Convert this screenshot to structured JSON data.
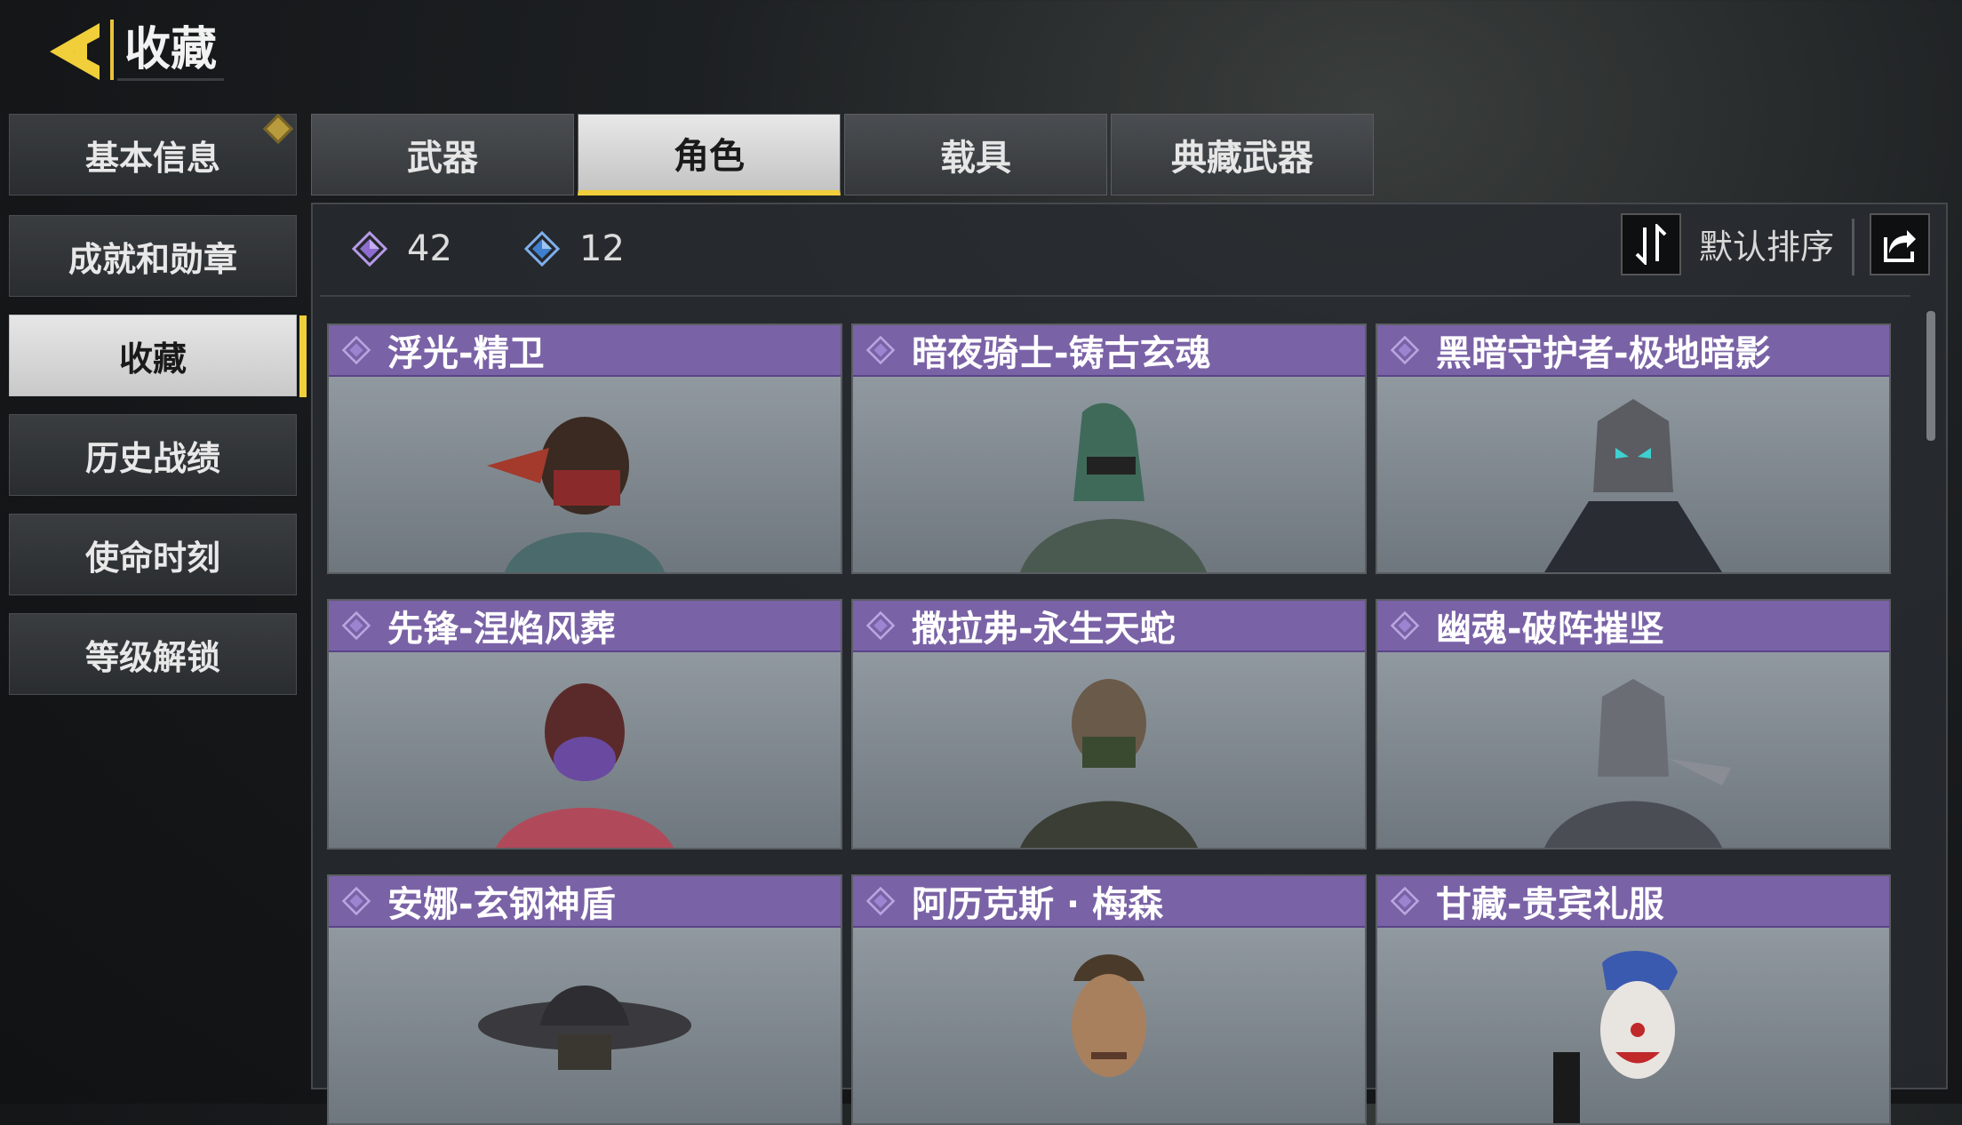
{
  "header": {
    "title": "收藏"
  },
  "sidebar": {
    "items": [
      {
        "label": "基本信息"
      },
      {
        "label": "成就和勋章"
      },
      {
        "label": "收藏"
      },
      {
        "label": "历史战绩"
      },
      {
        "label": "使命时刻"
      },
      {
        "label": "等级解锁"
      }
    ],
    "active_index": 2
  },
  "tabs": [
    {
      "label": "武器"
    },
    {
      "label": "角色"
    },
    {
      "label": "载具"
    },
    {
      "label": "典藏武器"
    }
  ],
  "active_tab": 1,
  "counts": {
    "purple": "42",
    "blue": "12"
  },
  "sort": {
    "label": "默认排序"
  },
  "cards": [
    {
      "name": "浮光-精卫"
    },
    {
      "name": "暗夜骑士-铸古玄魂"
    },
    {
      "name": "黑暗守护者-极地暗影"
    },
    {
      "name": "先锋-涅焰风葬"
    },
    {
      "name": "撒拉弗-永生天蛇"
    },
    {
      "name": "幽魂-破阵摧坚"
    },
    {
      "name": "安娜-玄钢神盾"
    },
    {
      "name": "阿历克斯 · 梅森"
    },
    {
      "name": "甘藏-贵宾礼服"
    }
  ],
  "colors": {
    "accent": "#f0cf3a",
    "card_header": "#7a62a6",
    "gem_purple": "#9a7ad8",
    "gem_blue": "#4a8ad8"
  }
}
